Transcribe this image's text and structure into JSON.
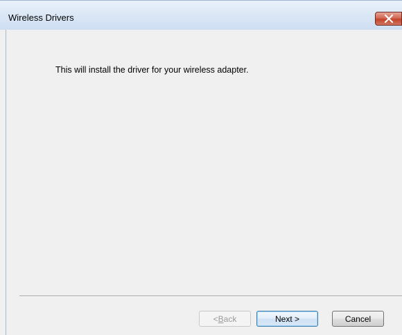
{
  "window": {
    "title": "Wireless Drivers",
    "close_icon": "close-icon"
  },
  "content": {
    "message": "This will install the driver for your wireless adapter."
  },
  "buttons": {
    "back": {
      "prefix": "< ",
      "mnemonic": "B",
      "rest": "ack",
      "enabled": false
    },
    "next": {
      "label": "Next >",
      "enabled": true,
      "default": true
    },
    "cancel": {
      "label": "Cancel",
      "enabled": true
    }
  },
  "colors": {
    "titlebar": "#dce8f6",
    "close_button": "#c3432a",
    "dialog_background": "#f0f0f0"
  }
}
